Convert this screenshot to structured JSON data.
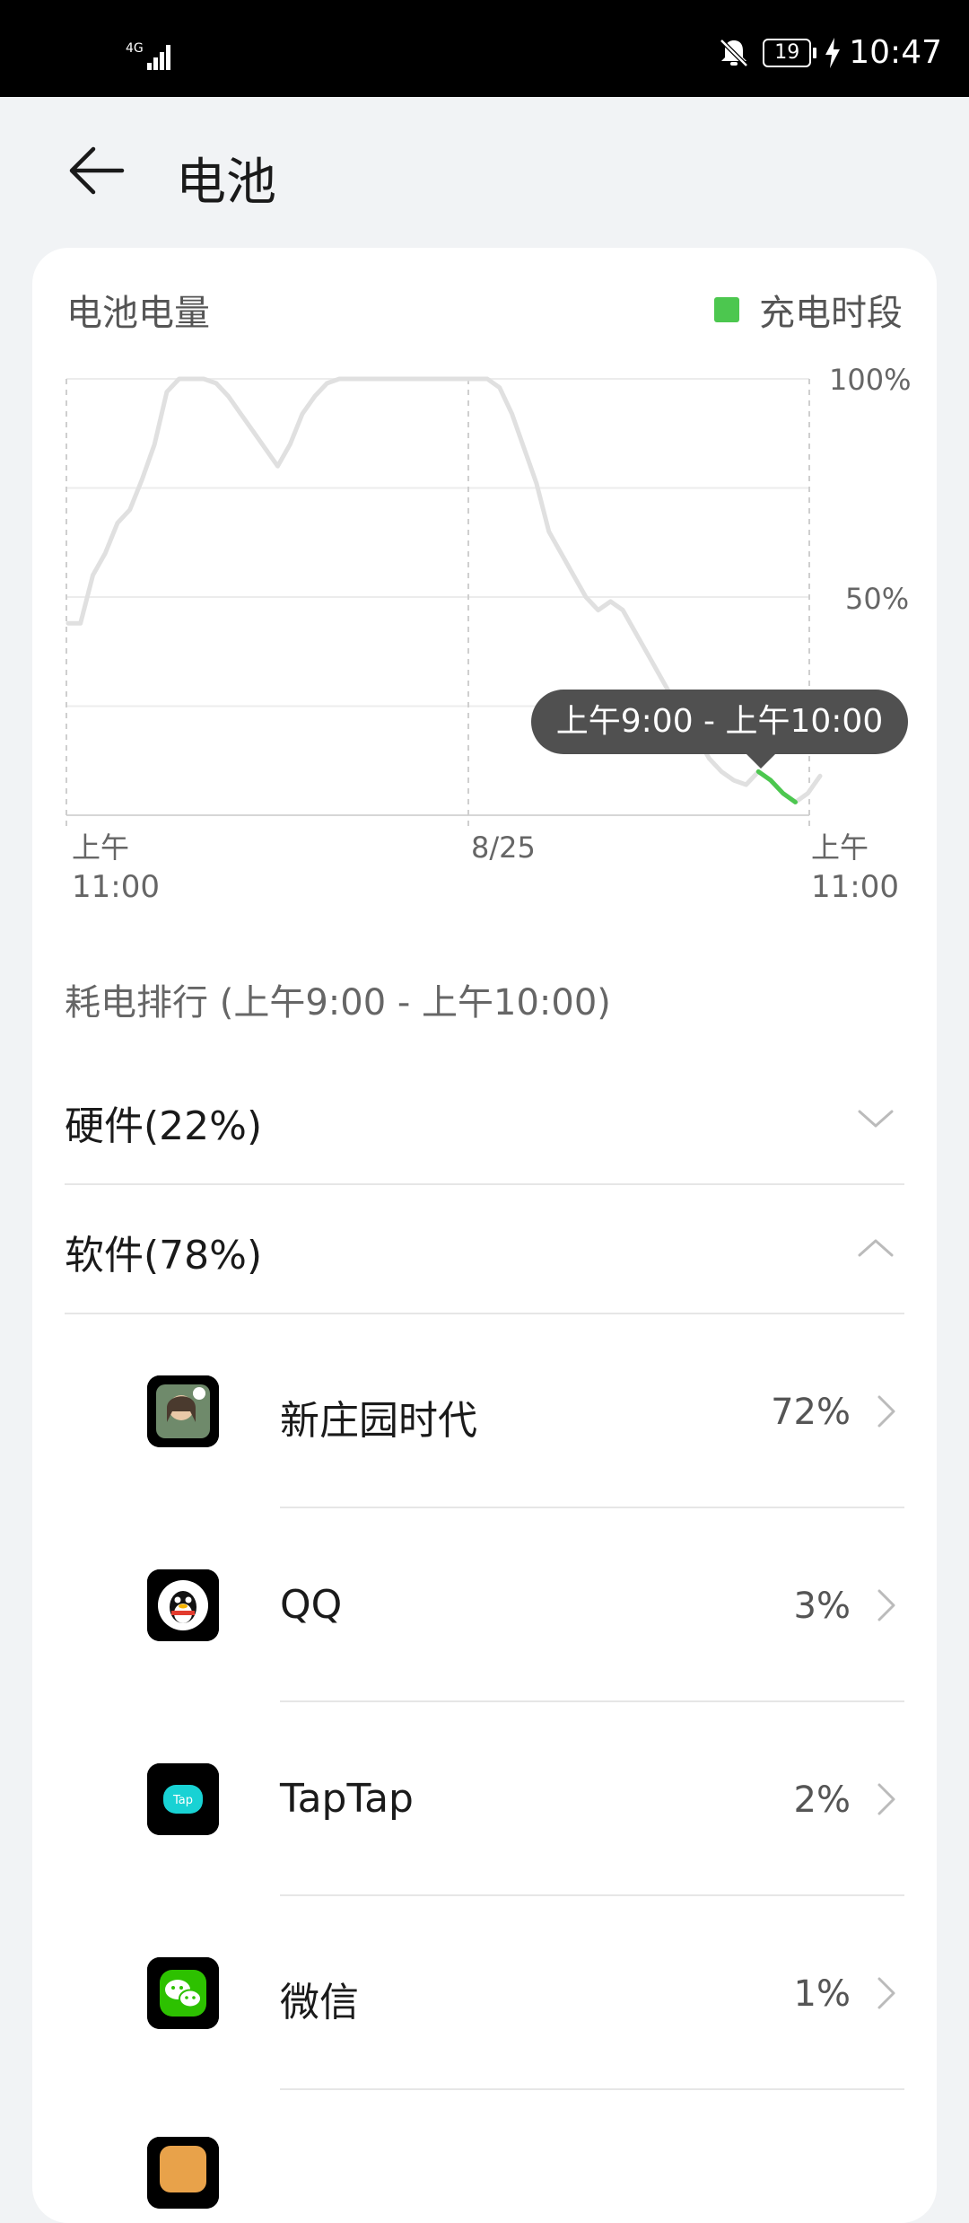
{
  "status_bar": {
    "network": "4G",
    "battery": "19",
    "time": "10:47"
  },
  "header": {
    "title": "电池"
  },
  "battery_card": {
    "title": "电池电量",
    "legend_label": "充电时段",
    "tooltip": "上午9:00 - 上午10:00",
    "colors": {
      "charging": "#4cc74f",
      "line": "#e0e0e0",
      "grid": "#ececec"
    },
    "chart_data": {
      "type": "line",
      "y_ticks": [
        "100%",
        "50%"
      ],
      "ylim": [
        0,
        100
      ],
      "x_labels": [
        {
          "top": "上午",
          "bottom": "11:00"
        },
        {
          "top": "8/25",
          "bottom": ""
        },
        {
          "top": "上午",
          "bottom": "11:00"
        }
      ],
      "series": [
        {
          "values": [
            44,
            44,
            55,
            60,
            67,
            70,
            77,
            85,
            97,
            100,
            100,
            100,
            99,
            96,
            92,
            88,
            84,
            80,
            85,
            92,
            96,
            99,
            100,
            100,
            100,
            100,
            100,
            100,
            100,
            100,
            100,
            100,
            100,
            100,
            100,
            98,
            92,
            84,
            76,
            65,
            60,
            55,
            50,
            47,
            49,
            47,
            42,
            37,
            32,
            27,
            23,
            18,
            13,
            10,
            8,
            7,
            10,
            8,
            5,
            3,
            5,
            9
          ]
        }
      ],
      "charging_segment_start_index": 56
    }
  },
  "ranking": {
    "title": "耗电排行 (上午9:00 - 上午10:00)",
    "hardware_label": "硬件(22%)",
    "software_label": "软件(78%)",
    "apps": [
      {
        "name": "新庄园时代",
        "percent": "72%",
        "icon": "farm-game-icon"
      },
      {
        "name": "QQ",
        "percent": "3%",
        "icon": "qq-penguin-icon"
      },
      {
        "name": "TapTap",
        "percent": "2%",
        "icon": "taptap-icon"
      },
      {
        "name": "微信",
        "percent": "1%",
        "icon": "wechat-icon"
      }
    ]
  }
}
